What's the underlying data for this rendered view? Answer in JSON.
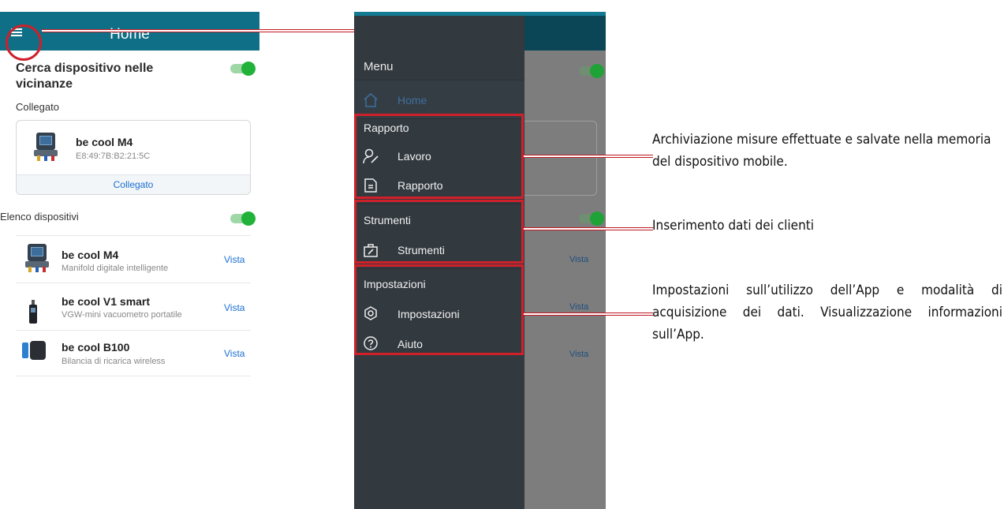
{
  "left": {
    "header_title": "Home",
    "nearby_title": "Cerca dispositivo nelle vicinanze",
    "connected_label": "Collegato",
    "connected_device": {
      "name": "be cool M4",
      "mac": "E8:49:7B:B2:21:5C",
      "status": "Collegato"
    },
    "devices_label": "Elenco dispositivi",
    "devices": [
      {
        "name": "be cool M4",
        "sub": "Manifold digitale intelligente",
        "action": "Vista"
      },
      {
        "name": "be cool V1 smart",
        "sub": "VGW-mini vacuometro portatile",
        "action": "Vista"
      },
      {
        "name": "be cool B100",
        "sub": "Bilancia di ricarica wireless",
        "action": "Vista"
      }
    ]
  },
  "drawer": {
    "menu_title": "Menu",
    "home_label": "Home",
    "groups": [
      {
        "title": "Rapporto",
        "items": [
          "Lavoro",
          "Rapporto"
        ]
      },
      {
        "title": "Strumenti",
        "items": [
          "Strumenti"
        ]
      },
      {
        "title": "Impostazioni",
        "items": [
          "Impostazioni",
          "Aiuto"
        ]
      }
    ],
    "bg_vista": [
      "Vista",
      "Vista",
      "Vista"
    ]
  },
  "annotations": [
    "Archiviazione misure effettuate e salvate nella memoria del dispositivo mobile.",
    "Inserimento dati dei clienti",
    "Impostazioni sull’utilizzo dell’App e modalità di acquisizione dei dati. Visualizzazione informazioni sull’App."
  ],
  "colors": {
    "header": "#0e6f86",
    "drawer": "#32393f",
    "highlight": "#d0202a",
    "link": "#1a6fd0",
    "toggle": "#22b23a"
  }
}
